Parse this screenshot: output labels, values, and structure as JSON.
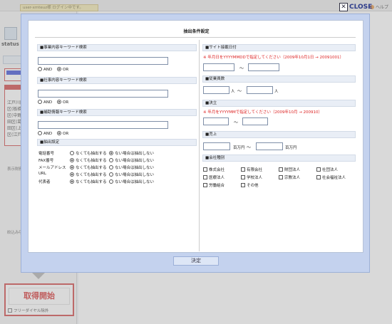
{
  "topbar": {
    "login_status": "user-xmteuz様 ログイン中です。",
    "help_label": "ヘルプ"
  },
  "sidebar": {
    "status_label": "status",
    "list_items": [
      "江戸川区",
      "区(板橋)",
      "区(中野)",
      "田区(葛",
      "田区(上",
      "区(江戸"
    ],
    "label_display": "表示財務",
    "label_narrow": "絞込み項",
    "link_text": "消去",
    "start_button": "取得開始",
    "exclude_free_dial": "フリーダイヤル除外"
  },
  "modal": {
    "close_label": "CLOSE",
    "title": "抽出条件設定",
    "decide_button": "決定",
    "left": {
      "business_keyword": {
        "heading": "■事業内容キーワード検索",
        "value": "",
        "and_label": "AND",
        "or_label": "OR",
        "selected": "OR"
      },
      "company_keyword": {
        "heading": "■社事内容キーワード検索",
        "value": "",
        "and_label": "AND",
        "or_label": "OR",
        "selected": "OR"
      },
      "detail_keyword": {
        "heading": "■補助情報キーワード検索",
        "value": "",
        "and_label": "AND",
        "or_label": "OR",
        "selected": "OR"
      },
      "extract_settings": {
        "heading": "■抽出設定",
        "option_a": "なくても抽出する",
        "option_b": "ない場合は抽出しない",
        "rows": [
          {
            "label": "電話番号",
            "selected": "b"
          },
          {
            "label": "FAX番号",
            "selected": "a"
          },
          {
            "label": "メールアドレス",
            "selected": "a"
          },
          {
            "label": "URL",
            "selected": "a"
          },
          {
            "label": "代表者",
            "selected": "a"
          }
        ]
      }
    },
    "right": {
      "update_date": {
        "heading": "■サイト接載日付",
        "note": "※ 年月日をYYYYMMDDで指定してください（2009年10月1日 → 20091001）",
        "from": "",
        "to": "",
        "tilde": "～"
      },
      "employees": {
        "heading": "■従業員数",
        "from": "",
        "to": "",
        "unit": "人",
        "tilde": "～"
      },
      "settlement": {
        "heading": "■決立",
        "note": "※ 年月をYYYYMMで指定してください（2009年10月 → 200910）",
        "from": "",
        "to": "",
        "tilde": "～"
      },
      "sales": {
        "heading": "■売上",
        "from": "",
        "to": "",
        "unit": "百万円",
        "tilde": "～"
      },
      "company_type": {
        "heading": "■会社種別",
        "items": [
          "株式会社",
          "有限会社",
          "財団法人",
          "社団法人",
          "医療法人",
          "学校法人",
          "宗教法人",
          "社会福祉法人",
          "労働組合",
          "その他"
        ]
      }
    }
  },
  "colors": {
    "accent": "#2d3b8a",
    "danger": "#d21f1f",
    "modal_bg": "#c4d2ee"
  }
}
